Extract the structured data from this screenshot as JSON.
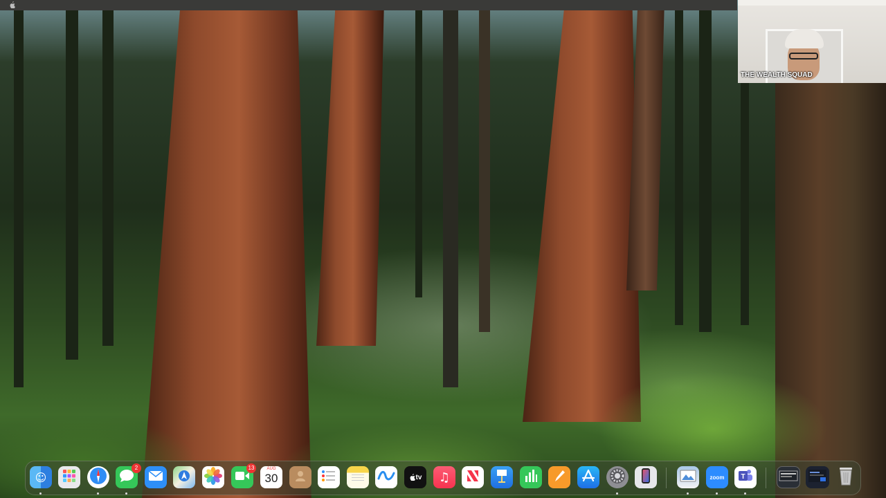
{
  "menubar": {
    "apple_glyph": ""
  },
  "video_tile": {
    "participant_name": "THE WEALTH SQUAD"
  },
  "dock": {
    "items": [
      {
        "name": "finder",
        "icon": "finder-icon"
      },
      {
        "name": "launchpad",
        "icon": "launchpad-icon"
      },
      {
        "name": "safari",
        "icon": "safari-icon"
      },
      {
        "name": "messages",
        "icon": "messages-icon",
        "badge": "2"
      },
      {
        "name": "mail",
        "icon": "mail-icon"
      },
      {
        "name": "maps",
        "icon": "maps-icon"
      },
      {
        "name": "photos",
        "icon": "photos-icon"
      },
      {
        "name": "facetime",
        "icon": "facetime-icon",
        "badge": "13"
      },
      {
        "name": "calendar",
        "icon": "calendar-icon",
        "month": "AUG",
        "day": "30"
      },
      {
        "name": "contacts",
        "icon": "contacts-icon"
      },
      {
        "name": "reminders",
        "icon": "reminders-icon"
      },
      {
        "name": "notes",
        "icon": "notes-icon"
      },
      {
        "name": "freeform",
        "icon": "freeform-icon"
      },
      {
        "name": "tv",
        "icon": "tv-icon",
        "label": "tv"
      },
      {
        "name": "music",
        "icon": "music-icon"
      },
      {
        "name": "news",
        "icon": "news-icon"
      },
      {
        "name": "keynote",
        "icon": "keynote-icon"
      },
      {
        "name": "numbers",
        "icon": "numbers-icon"
      },
      {
        "name": "pages",
        "icon": "pages-icon"
      },
      {
        "name": "app-store",
        "icon": "app-store-icon"
      },
      {
        "name": "system-settings",
        "icon": "gear-icon"
      },
      {
        "name": "iphone-mirroring",
        "icon": "iphone-icon"
      },
      {
        "name": "preview",
        "icon": "preview-icon"
      },
      {
        "name": "zoom",
        "icon": "zoom-icon",
        "label": "zoom"
      },
      {
        "name": "teams",
        "icon": "teams-icon"
      },
      {
        "name": "window-1",
        "icon": "minimized-window-icon"
      },
      {
        "name": "window-2",
        "icon": "minimized-window-icon"
      },
      {
        "name": "trash",
        "icon": "trash-icon"
      }
    ]
  }
}
